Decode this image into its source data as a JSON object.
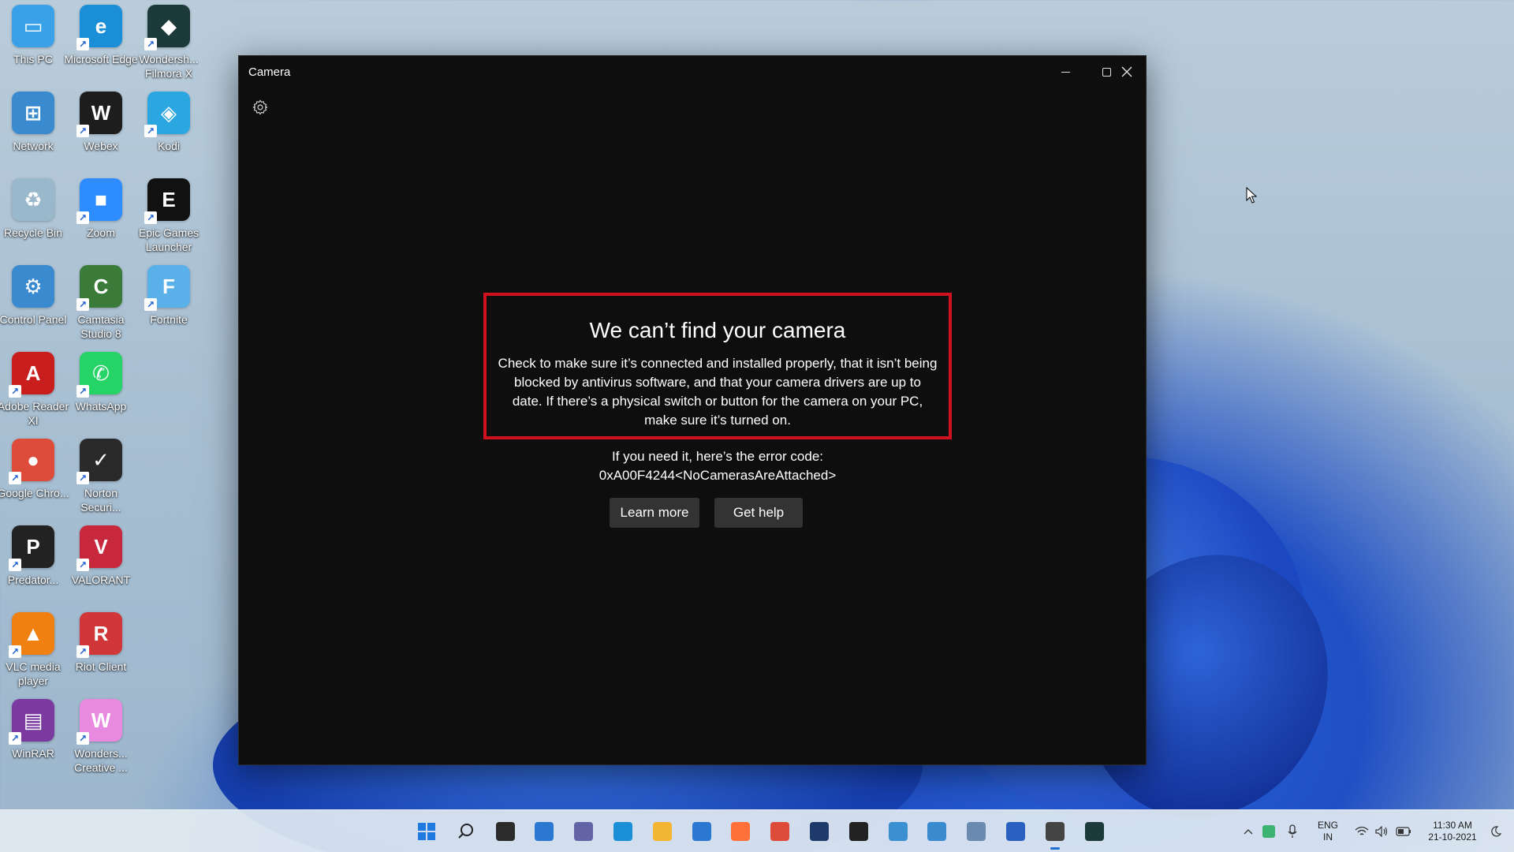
{
  "desktop": {
    "icons": [
      {
        "label": "This PC",
        "icon": "this-pc-icon",
        "color": "#3aa0e8"
      },
      {
        "label": "Microsoft Edge",
        "icon": "edge-icon",
        "color": "#1a8fd8"
      },
      {
        "label": "Wondersh... Filmora X",
        "icon": "filmora-icon",
        "color": "#1d3a3a"
      },
      {
        "label": "Network",
        "icon": "network-icon",
        "color": "#3a8ad0"
      },
      {
        "label": "Webex",
        "icon": "webex-icon",
        "color": "#1d1d1d"
      },
      {
        "label": "Kodi",
        "icon": "kodi-icon",
        "color": "#2aa6e0"
      },
      {
        "label": "Recycle Bin",
        "icon": "recycle-bin-icon",
        "color": "#9ab8cc"
      },
      {
        "label": "Zoom",
        "icon": "zoom-icon",
        "color": "#2d8cff"
      },
      {
        "label": "Epic Games Launcher",
        "icon": "epic-games-icon",
        "color": "#111111"
      },
      {
        "label": "Control Panel",
        "icon": "control-panel-icon",
        "color": "#3a8ad0"
      },
      {
        "label": "Camtasia Studio 8",
        "icon": "camtasia-icon",
        "color": "#3b7b3a"
      },
      {
        "label": "Fortnite",
        "icon": "fortnite-icon",
        "color": "#5ab0e8"
      },
      {
        "label": "Adobe Reader XI",
        "icon": "adobe-reader-icon",
        "color": "#c81e1e"
      },
      {
        "label": "WhatsApp",
        "icon": "whatsapp-icon",
        "color": "#25d366"
      },
      {
        "label": "Google Chro...",
        "icon": "chrome-beta-icon",
        "color": "#dd4b39"
      },
      {
        "label": "Norton Securi...",
        "icon": "norton-icon",
        "color": "#2a2a2a"
      },
      {
        "label": "Predator...",
        "icon": "predator-icon",
        "color": "#222222"
      },
      {
        "label": "VALORANT",
        "icon": "valorant-icon",
        "color": "#c8283c"
      },
      {
        "label": "VLC media player",
        "icon": "vlc-icon",
        "color": "#f08010"
      },
      {
        "label": "Riot Client",
        "icon": "riot-client-icon",
        "color": "#d13639"
      },
      {
        "label": "WinRAR",
        "icon": "winrar-icon",
        "color": "#7a3aa0"
      },
      {
        "label": "Wonders... Creative ...",
        "icon": "wondershare-creative-icon",
        "color": "#e88ae0"
      }
    ]
  },
  "window": {
    "title": "Camera",
    "error_title": "We can’t find your camera",
    "error_body": "Check to make sure it’s connected and installed properly, that it isn’t being blocked by antivirus software, and that your camera drivers are up to date. If there’s a physical switch or button for the camera on your PC, make sure it’s turned on.",
    "error_code_label": "If you need it, here’s the error code:",
    "error_code": "0xA00F4244<NoCamerasAreAttached>",
    "learn_more_label": "Learn more",
    "get_help_label": "Get help",
    "highlight_color": "#d0101c"
  },
  "taskbar": {
    "icons": [
      "start-icon",
      "search-icon",
      "task-view-icon",
      "widgets-icon",
      "teams-chat-icon",
      "edge-icon",
      "file-explorer-icon",
      "mail-icon",
      "firefox-icon",
      "chrome-icon",
      "app-icon",
      "dropbox-icon",
      "globe-app-icon",
      "notepad-icon",
      "photos-icon",
      "store-icon",
      "camera-icon",
      "filmora-icon"
    ],
    "language_line1": "ENG",
    "language_line2": "IN",
    "time": "11:30 AM",
    "date": "21-10-2021"
  }
}
